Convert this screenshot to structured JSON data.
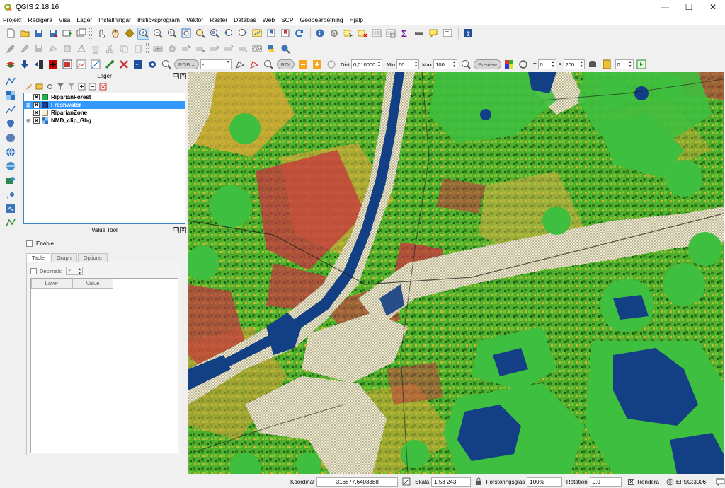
{
  "window": {
    "title": "QGIS 2.18.16",
    "minimize": "—",
    "maximize": "☐",
    "close": "✕"
  },
  "menu": [
    "Projekt",
    "Redigera",
    "Visa",
    "Lager",
    "Inställningar",
    "Insticksprogram",
    "Vektor",
    "Raster",
    "Databas",
    "Web",
    "SCP",
    "Geobearbetning",
    "Hjälp"
  ],
  "scp_toolbar": {
    "rgb_label": "RGB =",
    "rgb_value": "-",
    "roi_label": "ROI",
    "dist_label": "Dist",
    "dist_value": "0,010000",
    "min_label": "Min",
    "min_value": "60",
    "max_label": "Max",
    "max_value": "100",
    "preview_label": "Preview",
    "t_label": "T",
    "t_value": "0",
    "s_label": "S",
    "s_value": "200",
    "last_value": "0"
  },
  "layers_panel": {
    "title": "Lager",
    "layers": [
      {
        "name": "RiparianForest",
        "checked": "✕",
        "symbol_color": "#22b24c",
        "selected": false
      },
      {
        "name": "Freshwater",
        "checked": "✕",
        "symbol_color": "#1b3f8c",
        "selected": true
      },
      {
        "name": "RiparianZone",
        "checked": "✕",
        "symbol_color": "#f5f0d8",
        "selected": false
      },
      {
        "name": "NMD_clip_Gbg",
        "checked": "✕",
        "symbol_color": "#7a8fb0",
        "selected": false
      }
    ]
  },
  "value_tool": {
    "title": "Value Tool",
    "enable_label": "Enable",
    "tabs": [
      "Table",
      "Graph",
      "Options"
    ],
    "decimals_label": "Decimals",
    "decimals_value": "2",
    "columns": [
      "Layer",
      "Value"
    ]
  },
  "status_bar": {
    "coord_label": "Koordinat",
    "coord_value": "316877,6403388",
    "scale_label": "Skala",
    "scale_value": "1:53 243",
    "magnifier_label": "Förstoringsglas",
    "magnifier_value": "100%",
    "rotation_label": "Rotation",
    "rotation_value": "0,0",
    "render_label": "Rendera",
    "render_checked": "✕",
    "crs_label": "EPSG:3006"
  },
  "colors": {
    "forest": "#3fbf3f",
    "water": "#133f84",
    "riparian_zone": "#efe9cc",
    "urban": "#c8343f",
    "agriculture": "#e8a33a",
    "selection": "#3399ff"
  }
}
